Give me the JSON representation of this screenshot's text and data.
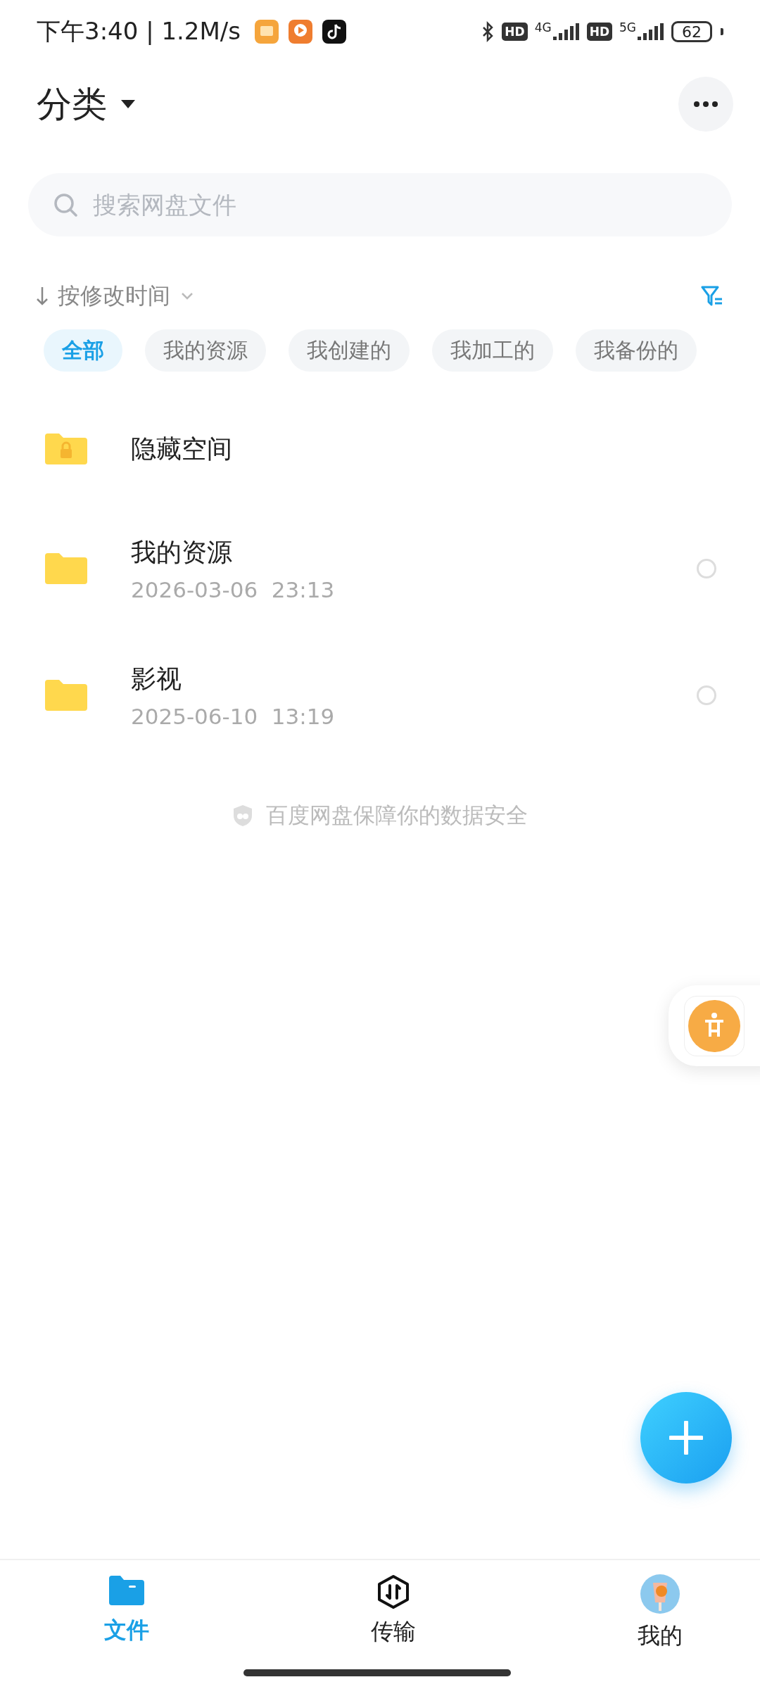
{
  "status_bar": {
    "time": "下午3:40 | 1.2M/s",
    "networks": [
      {
        "badge": "HD",
        "type": "4G"
      },
      {
        "badge": "HD",
        "type": "5G"
      }
    ],
    "battery": "62"
  },
  "header": {
    "title": "分类"
  },
  "search": {
    "placeholder": "搜索网盘文件"
  },
  "sort": {
    "label": "按修改时间"
  },
  "filters": [
    {
      "label": "全部",
      "selected": true
    },
    {
      "label": "我的资源",
      "selected": false
    },
    {
      "label": "我创建的",
      "selected": false
    },
    {
      "label": "我加工的",
      "selected": false
    },
    {
      "label": "我备份的",
      "selected": false
    }
  ],
  "files": [
    {
      "kind": "locked",
      "name": "隐藏空间"
    },
    {
      "kind": "folder",
      "name": "我的资源",
      "date": "2026-03-06  23:13",
      "checked": false
    },
    {
      "kind": "folder",
      "name": "影视",
      "date": "2025-06-10  13:19",
      "checked": false
    }
  ],
  "footer_note": "百度网盘保障你的数据安全",
  "nav": [
    {
      "label": "文件",
      "selected": true,
      "kind": "files"
    },
    {
      "label": "传输",
      "selected": false,
      "kind": "transfer"
    },
    {
      "label": "我的",
      "selected": false,
      "kind": "profile"
    }
  ]
}
